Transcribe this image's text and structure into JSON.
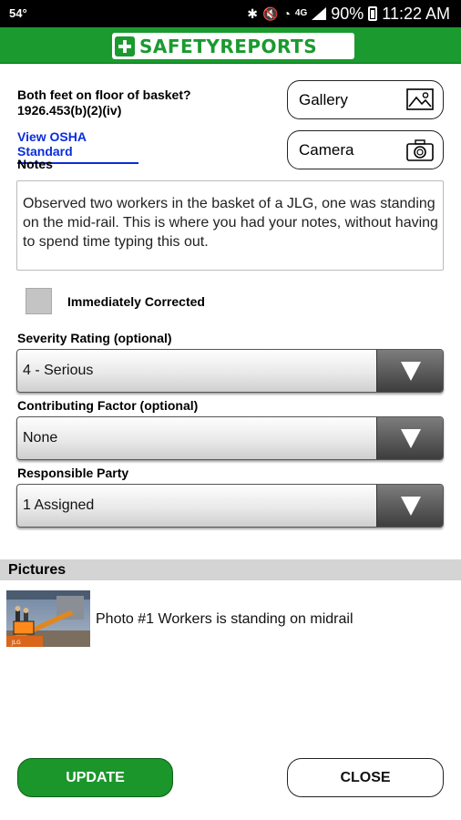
{
  "status_bar": {
    "temperature": "54°",
    "network": "4G",
    "battery": "90%",
    "time": "11:22 AM"
  },
  "header": {
    "logo_text": "SAFETYREPORTS",
    "brand_color": "#1a9a2f"
  },
  "question": {
    "text": "Both feet on floor of basket?",
    "code": "1926.453(b)(2)(iv)",
    "osha_link": "View OSHA Standard"
  },
  "media": {
    "gallery_label": "Gallery",
    "camera_label": "Camera"
  },
  "notes": {
    "label": "Notes",
    "value": "Observed two workers in the basket of a JLG, one was standing on the mid-rail. This is where you had your notes, without having to spend time typing this out."
  },
  "corrected": {
    "label": "Immediately Corrected",
    "checked": false
  },
  "severity": {
    "label": "Severity Rating (optional)",
    "value": "4 - Serious"
  },
  "contributing": {
    "label": "Contributing Factor (optional)",
    "value": "None"
  },
  "responsible": {
    "label": "Responsible Party",
    "value": "1 Assigned"
  },
  "pictures": {
    "header": "Pictures",
    "items": [
      {
        "caption": "Photo #1 Workers is standing on midrail"
      }
    ]
  },
  "actions": {
    "update_label": "UPDATE",
    "close_label": "CLOSE"
  }
}
